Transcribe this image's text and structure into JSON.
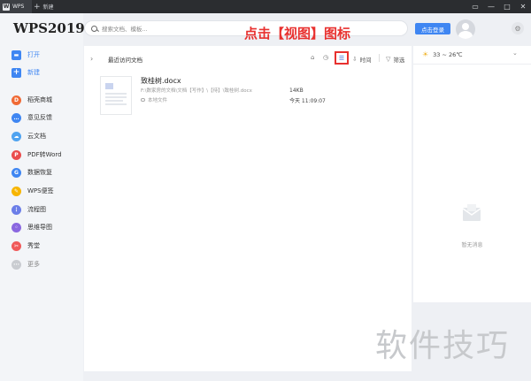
{
  "titlebar": {
    "app_tab_label": "WPS",
    "new_tab_label": "新建"
  },
  "sidebar": {
    "brand": "WPS2019",
    "items": [
      {
        "label": "打开",
        "icon": "folder-icon",
        "color": "#3f86f2"
      },
      {
        "label": "新建",
        "icon": "plus-icon",
        "color": "#3f86f2"
      },
      {
        "label": "稻壳商城",
        "icon": "shop-icon",
        "color": "#f06a35"
      },
      {
        "label": "意见反馈",
        "icon": "feedback-icon",
        "color": "#3f86f2"
      },
      {
        "label": "云文档",
        "icon": "cloud-doc-icon",
        "color": "#4fa3f0"
      },
      {
        "label": "PDF转Word",
        "icon": "pdf-icon",
        "color": "#ea4d4d"
      },
      {
        "label": "数据恢复",
        "icon": "data-recovery-icon",
        "color": "#3f86f2"
      },
      {
        "label": "WPS便签",
        "icon": "note-icon",
        "color": "#f7b500"
      },
      {
        "label": "流程图",
        "icon": "flowchart-icon",
        "color": "#6b7ee8"
      },
      {
        "label": "思维导图",
        "icon": "mindmap-icon",
        "color": "#8a67e0"
      },
      {
        "label": "秀堂",
        "icon": "xiutang-icon",
        "color": "#f05a5a"
      },
      {
        "label": "更多",
        "icon": "more-icon",
        "color": "#c9ccd1"
      }
    ]
  },
  "search": {
    "placeholder": "搜索文档、模板..."
  },
  "annotation": {
    "text": "点击【视图】图标",
    "color": "#e8312f"
  },
  "header": {
    "login_label": "点击登录"
  },
  "main": {
    "section_title": "最近访问文档",
    "sort_label": "时间",
    "filter_label": "筛选",
    "files": [
      {
        "name": "致桂树.docx",
        "path": "F:\\数家房的文档\\文档【写作】\\【待】\\致桂树.docx",
        "location": "本地文件",
        "size": "14KB",
        "time": "今天 11:09:07"
      }
    ]
  },
  "right_panel": {
    "weather": "33 ~ 26℃",
    "empty_text": "暂无消息"
  },
  "watermark": "软件技巧",
  "colors": {
    "accent": "#3f86f2",
    "annotation_red": "#e8312f"
  }
}
